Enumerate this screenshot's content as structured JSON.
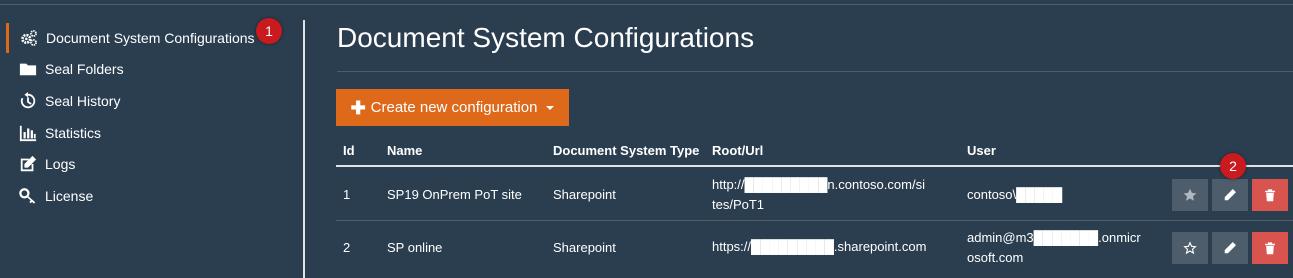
{
  "sidebar": {
    "items": [
      {
        "label": "Document System Configurations",
        "icon": "cogs-icon"
      },
      {
        "label": "Seal Folders",
        "icon": "folder-icon"
      },
      {
        "label": "Seal History",
        "icon": "history-icon"
      },
      {
        "label": "Statistics",
        "icon": "bar-chart-icon"
      },
      {
        "label": "Logs",
        "icon": "edit-icon"
      },
      {
        "label": "License",
        "icon": "key-icon"
      }
    ]
  },
  "markers": {
    "one": "1",
    "two": "2"
  },
  "main": {
    "title": "Document System Configurations",
    "create_button": "Create new configuration"
  },
  "table": {
    "columns": [
      "Id",
      "Name",
      "Document System Type",
      "Root/Url",
      "User"
    ],
    "rows": [
      {
        "id": "1",
        "name": "SP19 OnPrem PoT site",
        "type": "Sharepoint",
        "url_line1": "http://█████████n.contoso.com/si",
        "url_line2": "tes/PoT1",
        "user_line1": "contoso\\█████",
        "user_line2": "",
        "starred": true
      },
      {
        "id": "2",
        "name": "SP online",
        "type": "Sharepoint",
        "url_line1": "https://█████████.sharepoint.com",
        "url_line2": "",
        "user_line1": "admin@m3███████.onmicr",
        "user_line2": "osoft.com",
        "starred": false
      }
    ]
  },
  "colors": {
    "accent": "#df691a",
    "background": "#2b3e50",
    "danger": "#d9534f",
    "marker": "#c81a1f"
  }
}
